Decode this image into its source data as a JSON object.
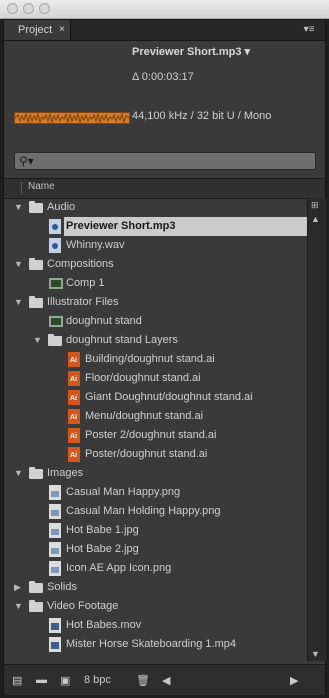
{
  "panel": {
    "tab_label": "Project",
    "tab_close": "×",
    "menu_glyph": "▾≡"
  },
  "preview": {
    "title": "Previewer Short.mp3 ▾",
    "duration": "Δ 0:00:03:17",
    "audio_info": "44,100 kHz / 32 bit U / Mono"
  },
  "search": {
    "icon": "search-icon",
    "glyph": "⚲▾",
    "placeholder": ""
  },
  "columns": {
    "name": "Name"
  },
  "items": [
    {
      "label": "Audio",
      "kind": "folder",
      "level": 0,
      "expanded": true
    },
    {
      "label": "Previewer Short.mp3",
      "kind": "audio",
      "level": 1,
      "selected": true
    },
    {
      "label": "Whinny.wav",
      "kind": "audio",
      "level": 1
    },
    {
      "label": "Compositions",
      "kind": "folder",
      "level": 0,
      "expanded": true
    },
    {
      "label": "Comp 1",
      "kind": "comp",
      "level": 1
    },
    {
      "label": "Illustrator Files",
      "kind": "folder",
      "level": 0,
      "expanded": true
    },
    {
      "label": "doughnut stand",
      "kind": "comp",
      "level": 1
    },
    {
      "label": "doughnut stand Layers",
      "kind": "folder",
      "level": 1,
      "expanded": true
    },
    {
      "label": "Building/doughnut stand.ai",
      "kind": "ai",
      "level": 2
    },
    {
      "label": "Floor/doughnut stand.ai",
      "kind": "ai",
      "level": 2
    },
    {
      "label": "Giant Doughnut/doughnut stand.ai",
      "kind": "ai",
      "level": 2
    },
    {
      "label": "Menu/doughnut stand.ai",
      "kind": "ai",
      "level": 2
    },
    {
      "label": "Poster 2/doughnut stand.ai",
      "kind": "ai",
      "level": 2
    },
    {
      "label": "Poster/doughnut stand.ai",
      "kind": "ai",
      "level": 2
    },
    {
      "label": "Images",
      "kind": "folder",
      "level": 0,
      "expanded": true
    },
    {
      "label": "Casual Man Happy.png",
      "kind": "image",
      "level": 1
    },
    {
      "label": "Casual Man Holding Happy.png",
      "kind": "image",
      "level": 1
    },
    {
      "label": "Hot Babe 1.jpg",
      "kind": "image",
      "level": 1
    },
    {
      "label": "Hot Babe 2.jpg",
      "kind": "image",
      "level": 1
    },
    {
      "label": "Icon AE App Icon.png",
      "kind": "image",
      "level": 1
    },
    {
      "label": "Solids",
      "kind": "folder",
      "level": 0,
      "expanded": false
    },
    {
      "label": "Video Footage",
      "kind": "folder",
      "level": 0,
      "expanded": true
    },
    {
      "label": "Hot Babes.mov",
      "kind": "video",
      "level": 1
    },
    {
      "label": "Mister Horse Skateboarding 1.mp4",
      "kind": "video",
      "level": 1
    }
  ],
  "bottom": {
    "bpc_label": "8 bpc"
  },
  "colors": {
    "selection": "#cbcbcb",
    "waveform": "#d47b26",
    "ai_icon": "#d4561c"
  }
}
